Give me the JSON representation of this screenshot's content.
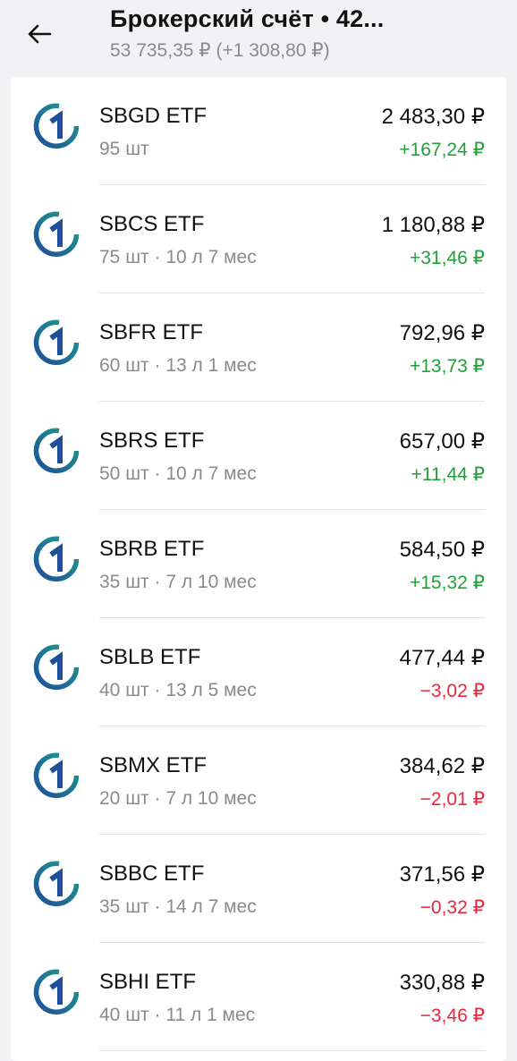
{
  "header": {
    "title": "Брокерский счёт • 42...",
    "subtitle": "53 735,35 ₽ (+1 308,80 ₽)"
  },
  "colors": {
    "positive": "#21a038",
    "negative": "#e8263e",
    "logo_dark": "#1f4e9a",
    "logo_teal": "#1f9f8b"
  },
  "icons": {
    "back": "arrow-left-icon",
    "fund_logo": "sber-fund-logo"
  },
  "holdings": [
    {
      "name": "SBGD ETF",
      "meta": "95 шт",
      "price": "2 483,30 ₽",
      "change": "+167,24 ₽",
      "direction": "positive"
    },
    {
      "name": "SBCS ETF",
      "meta": "75 шт · 10 л 7 мес",
      "price": "1 180,88 ₽",
      "change": "+31,46 ₽",
      "direction": "positive"
    },
    {
      "name": "SBFR ETF",
      "meta": "60 шт · 13 л 1 мес",
      "price": "792,96 ₽",
      "change": "+13,73 ₽",
      "direction": "positive"
    },
    {
      "name": "SBRS ETF",
      "meta": "50 шт · 10 л 7 мес",
      "price": "657,00 ₽",
      "change": "+11,44 ₽",
      "direction": "positive"
    },
    {
      "name": "SBRB ETF",
      "meta": "35 шт · 7 л 10 мес",
      "price": "584,50 ₽",
      "change": "+15,32 ₽",
      "direction": "positive"
    },
    {
      "name": "SBLB ETF",
      "meta": "40 шт · 13 л 5 мес",
      "price": "477,44 ₽",
      "change": "−3,02 ₽",
      "direction": "negative"
    },
    {
      "name": "SBMX ETF",
      "meta": "20 шт · 7 л 10 мес",
      "price": "384,62 ₽",
      "change": "−2,01 ₽",
      "direction": "negative"
    },
    {
      "name": "SBBC ETF",
      "meta": "35 шт · 14 л 7 мес",
      "price": "371,56 ₽",
      "change": "−0,32 ₽",
      "direction": "negative"
    },
    {
      "name": "SBHI ETF",
      "meta": "40 шт · 11 л 1 мес",
      "price": "330,88 ₽",
      "change": "−3,46 ₽",
      "direction": "negative"
    }
  ]
}
